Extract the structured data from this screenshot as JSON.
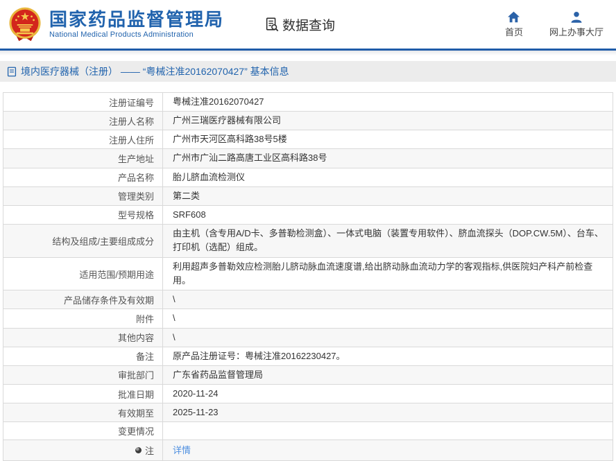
{
  "header": {
    "title": "国家药品监督管理局",
    "subtitle": "National Medical Products Administration",
    "section_tab": "数据查询",
    "nav": {
      "home": "首页",
      "service_hall": "网上办事大厅"
    },
    "colors": {
      "brand_blue": "#2163ad",
      "divider_blue": "#1f5ca9",
      "emblem_red": "#d3261c",
      "emblem_gold": "#e9b63d"
    }
  },
  "breadcrumb": {
    "text": "境内医疗器械（注册） ——  “粤械注准20162070427” 基本信息"
  },
  "table": {
    "rows": [
      {
        "label": "注册证编号",
        "value": "粤械注准20162070427"
      },
      {
        "label": "注册人名称",
        "value": "广州三瑞医疗器械有限公司"
      },
      {
        "label": "注册人住所",
        "value": "广州市天河区高科路38号5楼"
      },
      {
        "label": "生产地址",
        "value": "广州市广汕二路高唐工业区高科路38号"
      },
      {
        "label": "产品名称",
        "value": "胎儿脐血流检测仪"
      },
      {
        "label": "管理类别",
        "value": "第二类"
      },
      {
        "label": "型号规格",
        "value": "SRF608"
      },
      {
        "label": "结构及组成/主要组成成分",
        "value": "由主机（含专用A/D卡、多普勒检测盒）、一体式电脑（装置专用软件）、脐血流探头（DOP.CW.5M）、台车、打印机（选配）组成。"
      },
      {
        "label": "适用范围/预期用途",
        "value": "利用超声多普勒效应检测胎儿脐动脉血流速度谱,给出脐动脉血流动力学的客观指标,供医院妇产科产前检查用。"
      },
      {
        "label": "产品储存条件及有效期",
        "value": "\\"
      },
      {
        "label": "附件",
        "value": "\\"
      },
      {
        "label": "其他内容",
        "value": "\\"
      },
      {
        "label": "备注",
        "value": "原产品注册证号：粤械注准20162230427。"
      },
      {
        "label": "审批部门",
        "value": "广东省药品监督管理局"
      },
      {
        "label": "批准日期",
        "value": "2020-11-24"
      },
      {
        "label": "有效期至",
        "value": "2025-11-23"
      },
      {
        "label": "变更情况",
        "value": ""
      },
      {
        "label": "注",
        "value": "详情"
      }
    ],
    "link_color": "#4e8fe0"
  }
}
